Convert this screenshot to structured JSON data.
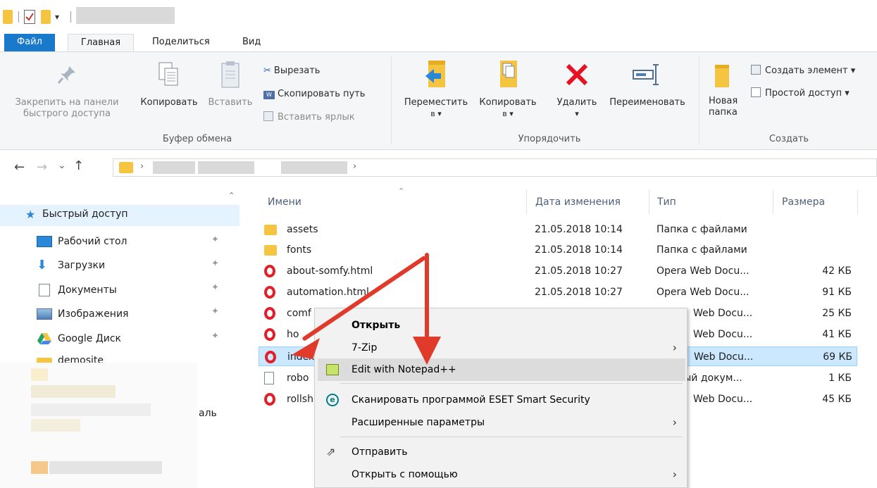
{
  "ribbon_tabs": {
    "file": "Файл",
    "home": "Главная",
    "share": "Поделиться",
    "view": "Вид"
  },
  "clipboard": {
    "pin": "Закрепить на панели быстрого доступа",
    "copy": "Копировать",
    "paste": "Вставить",
    "cut": "Вырезать",
    "copy_path": "Скопировать путь",
    "paste_shortcut": "Вставить ярлык",
    "group": "Буфер обмена"
  },
  "organize": {
    "move_to_1": "Переместить",
    "move_to_2": "в ▾",
    "copy_to_1": "Копировать",
    "copy_to_2": "в ▾",
    "delete": "Удалить",
    "delete_arrow": "▾",
    "rename": "Переименовать",
    "group": "Упорядочить"
  },
  "create": {
    "new_folder_1": "Новая",
    "new_folder_2": "папка",
    "new_item": "Создать элемент ▾",
    "easy_access": "Простой доступ ▾",
    "group": "Создать"
  },
  "nav": {
    "back": "←",
    "forward": "→",
    "recent": "⌄",
    "up": "↑",
    "sep1": "›",
    "sep2": "›"
  },
  "sidebar": {
    "quick_access": "Быстрый доступ",
    "items": [
      {
        "label": "Рабочий стол"
      },
      {
        "label": "Загрузки"
      },
      {
        "label": "Документы"
      },
      {
        "label": "Изображения"
      },
      {
        "label": "Google Диск"
      },
      {
        "label": "demosite"
      }
    ],
    "partial": "аль"
  },
  "columns": {
    "name": "Имени",
    "date": "Дата изменения",
    "type": "Тип",
    "size": "Размера"
  },
  "files": [
    {
      "name": "assets",
      "date": "21.05.2018 10:14",
      "type": "Папка с файлами",
      "size": "",
      "icon": "folder-icon"
    },
    {
      "name": "fonts",
      "date": "21.05.2018 10:14",
      "type": "Папка с файлами",
      "size": "",
      "icon": "folder-icon"
    },
    {
      "name": "about-somfy.html",
      "date": "21.05.2018 10:27",
      "type": "Opera Web Docu...",
      "size": "42 КБ",
      "icon": "opera-icon"
    },
    {
      "name": "automation.html",
      "date": "21.05.2018 10:27",
      "type": "Opera Web Docu...",
      "size": "91 КБ",
      "icon": "opera-icon"
    },
    {
      "name": "comf",
      "date": "",
      "type": "Web Docu...",
      "size": "25 КБ",
      "icon": "opera-icon"
    },
    {
      "name": "ho",
      "date": "",
      "type": "Web Docu...",
      "size": "41 КБ",
      "icon": "opera-icon"
    },
    {
      "name": "index",
      "date": "",
      "type": "Web Docu...",
      "size": "69 КБ",
      "icon": "opera-icon"
    },
    {
      "name": "robo",
      "date": "",
      "type": "вый докум...",
      "size": "1 КБ",
      "icon": "text-file-icon"
    },
    {
      "name": "rollsh",
      "date": "",
      "type": "Web Docu...",
      "size": "45 КБ",
      "icon": "opera-icon"
    }
  ],
  "context_menu": {
    "open": "Открыть",
    "sevenzip": "7-Zip",
    "notepad": "Edit with Notepad++",
    "eset": "Сканировать программой ESET Smart Security",
    "advanced": "Расширенные параметры",
    "send": "Отправить",
    "open_with": "Открыть с помощью",
    "chevron": "›"
  },
  "colors": {
    "accent": "#1979ca",
    "selection": "#cce8ff",
    "arrow": "#e03a2a",
    "opera": "#e0202a",
    "folder": "#f5c542"
  }
}
